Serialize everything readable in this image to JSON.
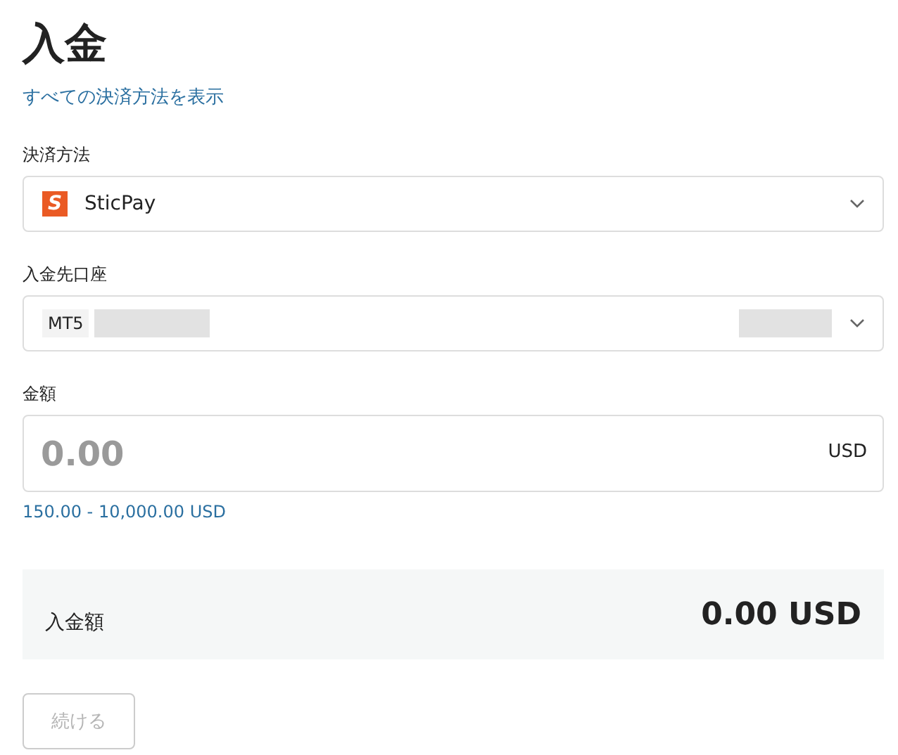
{
  "title": "入金",
  "all_methods_link": "すべての決済方法を表示",
  "payment_method": {
    "label": "決済方法",
    "logo_text": "S",
    "value": "SticPay"
  },
  "account": {
    "label": "入金先口座",
    "prefix": "MT5"
  },
  "amount": {
    "label": "金額",
    "placeholder": "0.00",
    "currency": "USD",
    "range": "150.00 - 10,000.00 USD"
  },
  "summary": {
    "label": "入金額",
    "value": "0.00 USD"
  },
  "continue_button": {
    "label": "続ける",
    "disabled": true
  }
}
